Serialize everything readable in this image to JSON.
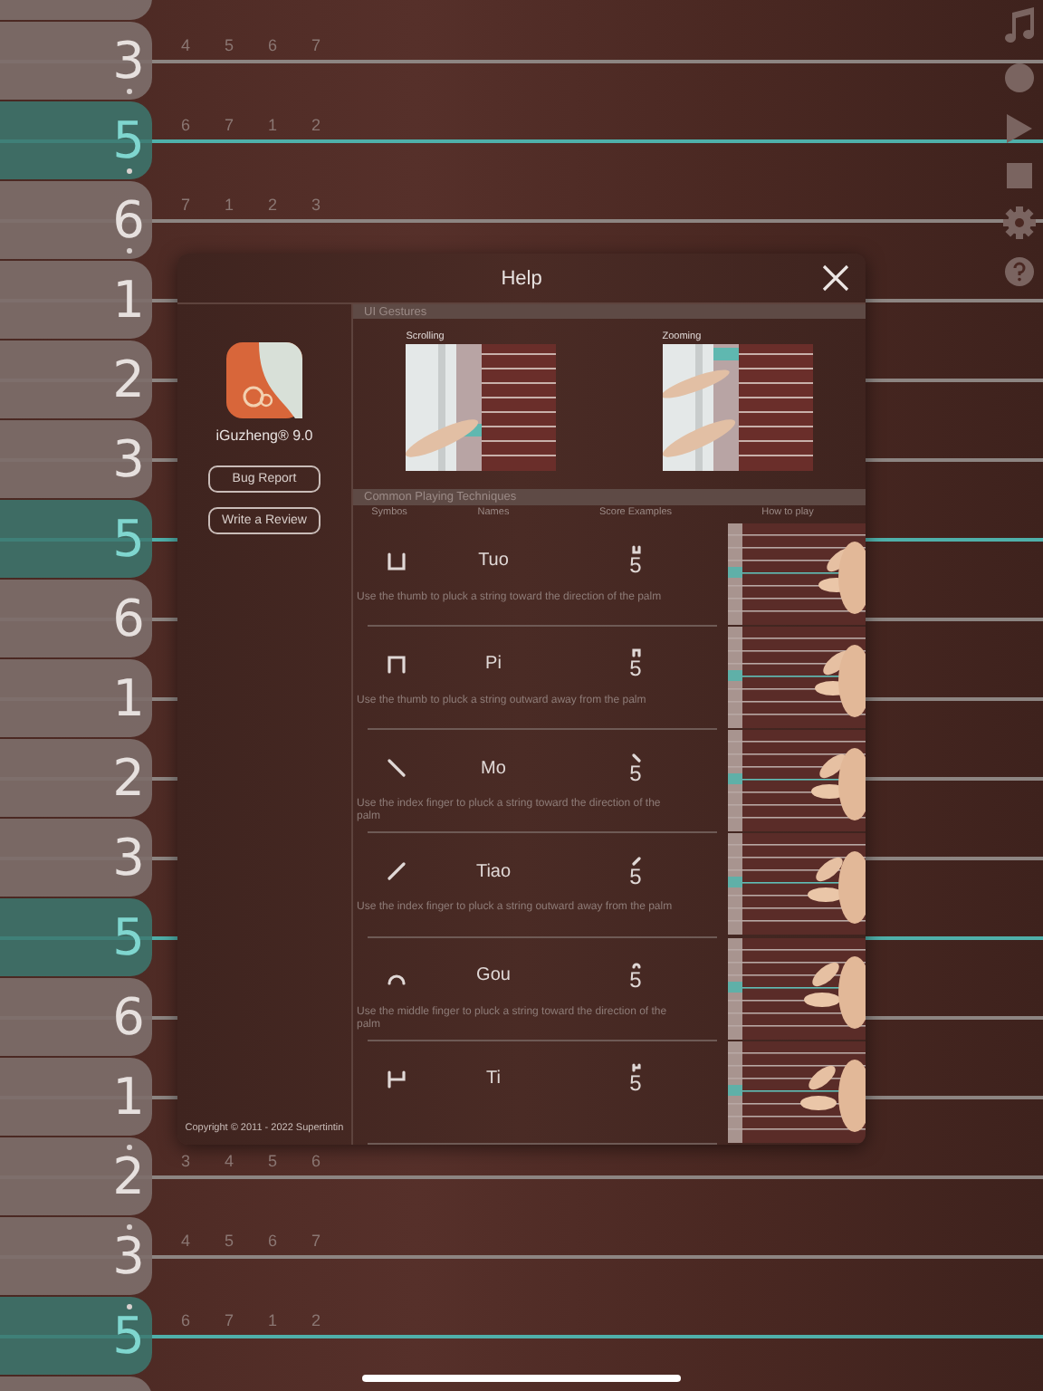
{
  "keys": [
    {
      "number": "3",
      "highlighted": false,
      "octave_up": false,
      "marks": [
        "4",
        "5",
        "6",
        "7"
      ]
    },
    {
      "number": "5",
      "highlighted": true,
      "octave_up": false,
      "marks": [
        "6",
        "7",
        "1",
        "2"
      ]
    },
    {
      "number": "6",
      "highlighted": false,
      "octave_up": false,
      "marks": [
        "7",
        "1",
        "2",
        "3"
      ]
    },
    {
      "number": "1",
      "highlighted": false
    },
    {
      "number": "2",
      "highlighted": false
    },
    {
      "number": "3",
      "highlighted": false
    },
    {
      "number": "5",
      "highlighted": true
    },
    {
      "number": "6",
      "highlighted": false
    },
    {
      "number": "1",
      "highlighted": false
    },
    {
      "number": "2",
      "highlighted": false
    },
    {
      "number": "3",
      "highlighted": false
    },
    {
      "number": "5",
      "highlighted": true
    },
    {
      "number": "6",
      "highlighted": false
    },
    {
      "number": "1",
      "highlighted": false
    },
    {
      "number": "2",
      "highlighted": false,
      "octave_up": true,
      "marks": [
        "3",
        "4",
        "5",
        "6"
      ]
    },
    {
      "number": "3",
      "highlighted": false,
      "octave_up": true,
      "marks": [
        "4",
        "5",
        "6",
        "7"
      ]
    },
    {
      "number": "5",
      "highlighted": true,
      "octave_up": true,
      "marks": [
        "6",
        "7",
        "1",
        "2"
      ]
    }
  ],
  "dialog": {
    "title": "Help",
    "app_name": "iGuzheng® 9.0",
    "buttons": [
      "Bug Report",
      "Write a Review"
    ],
    "copyright": "Copyright © 2011 - 2022 Supertintin",
    "gestures": {
      "title": "UI Gestures",
      "items": [
        "Scrolling",
        "Zooming"
      ]
    },
    "techniques": {
      "title": "Common Playing Techniques",
      "columns": [
        "Symbos",
        "Names",
        "Score Examples",
        "How to play"
      ],
      "rows": [
        {
          "kind": "tuo",
          "name": "Tuo",
          "score": "5",
          "description": "Use the thumb to pluck a string toward the direction of the palm"
        },
        {
          "kind": "pi",
          "name": "Pi",
          "score": "5",
          "description": "Use the thumb to pluck a string outward away from the palm"
        },
        {
          "kind": "mo",
          "name": "Mo",
          "score": "5",
          "description": "Use the index finger to pluck a string toward the direction of the palm"
        },
        {
          "kind": "tiao",
          "name": "Tiao",
          "score": "5",
          "description": "Use the index finger to pluck a string outward away from the palm"
        },
        {
          "kind": "gou",
          "name": "Gou",
          "score": "5",
          "description": "Use the middle finger to pluck a string toward the direction of the palm"
        },
        {
          "kind": "ti",
          "name": "Ti",
          "score": "5"
        }
      ]
    }
  }
}
